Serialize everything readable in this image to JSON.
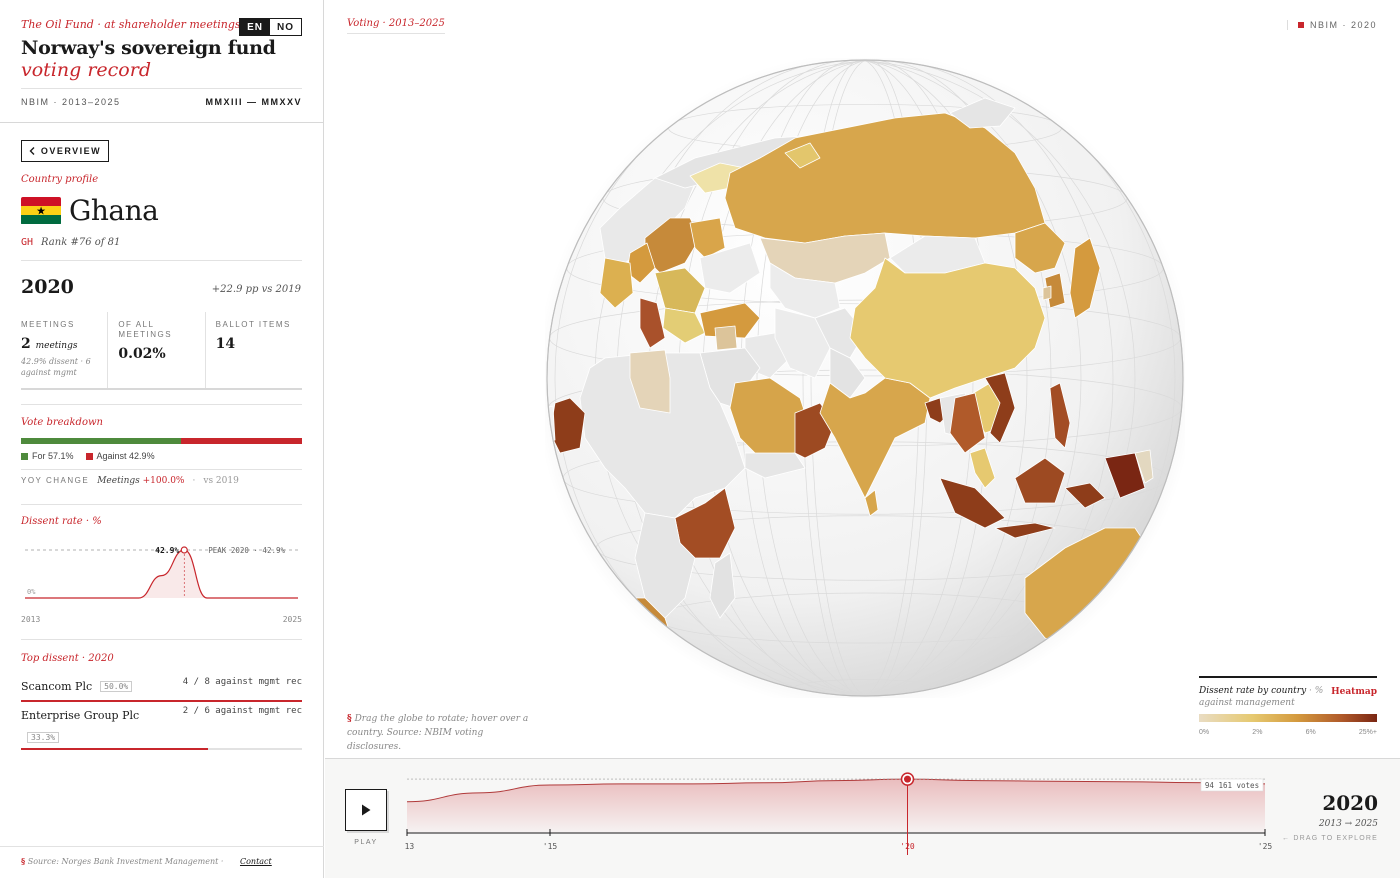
{
  "header": {
    "kicker": "The Oil Fund · at shareholder meetings",
    "title_line1": "Norway's sovereign fund",
    "title_line2": "voting record",
    "lang_en": "EN",
    "lang_no": "NO",
    "meta_left": "NBIM · 2013–2025",
    "meta_right": "MMXIII — MMXXV"
  },
  "profile": {
    "overview_label": "OVERVIEW",
    "section_label": "Country profile",
    "country": "Ghana",
    "code": "GH",
    "rank": "Rank #76 of 81",
    "year": "2020",
    "yoy": "+22.9 pp vs 2019",
    "stats": {
      "meetings_key": "MEETINGS",
      "meetings_value": "2",
      "meetings_unit": "meetings",
      "meetings_note": "42.9% dissent · 6 against mgmt",
      "share_key": "OF ALL MEETINGS",
      "share_value": "0.02%",
      "ballot_key": "BALLOT ITEMS",
      "ballot_value": "14"
    },
    "vote_label": "Vote breakdown",
    "vote_for_pct": 57.1,
    "vote_against_pct": 42.9,
    "vote_for_label": "For 57.1%",
    "vote_against_label": "Against 42.9%",
    "yoy_key": "YOY CHANGE",
    "yoy_metric": "Meetings",
    "yoy_value": "+100.0%",
    "yoy_vs": "vs 2019",
    "dissent_label": "Dissent rate · %",
    "top_label": "Top dissent · 2020",
    "top": [
      {
        "name": "Scancom Plc",
        "pct": "50.0%",
        "count": "4 / 8 against mgmt rec",
        "share": 1.0
      },
      {
        "name": "Enterprise Group Plc",
        "pct": "33.3%",
        "count": "2 / 6 against mgmt rec",
        "share": 0.667
      }
    ],
    "footer_source": "Source: Norges Bank Investment Management",
    "footer_contact": "Contact",
    "footer_mark": "§"
  },
  "chart_data": [
    {
      "type": "line",
      "title": "Dissent rate · %",
      "x": [
        2013,
        2014,
        2015,
        2016,
        2017,
        2018,
        2019,
        2020,
        2021,
        2022,
        2023,
        2024,
        2025
      ],
      "values": [
        0,
        0,
        0,
        0,
        0,
        0,
        20.0,
        42.9,
        0,
        0,
        0,
        0,
        0
      ],
      "ylim": [
        0,
        42.9
      ],
      "peak_label": "42.9%",
      "peak_note": "PEAK 2020 · 42.9%",
      "zero_label": "0%",
      "x_start_label": "2013",
      "x_end_label": "2025"
    },
    {
      "type": "area",
      "x": [
        2013,
        2014,
        2015,
        2016,
        2017,
        2018,
        2019,
        2020,
        2021,
        2022,
        2023,
        2024,
        2025
      ],
      "values": [
        84000,
        88000,
        91500,
        92000,
        92000,
        92500,
        93500,
        94161,
        93500,
        93200,
        93000,
        92600,
        92000
      ],
      "ylim": [
        0,
        96000
      ],
      "tick_labels": [
        "'13",
        "'15",
        "'20",
        "'25"
      ],
      "tick_years": [
        2013,
        2015,
        2020,
        2025
      ],
      "selected_year": 2020,
      "selected_label": "94 161 votes"
    }
  ],
  "map": {
    "tag": "Voting · 2013–2025",
    "corner": "NBIM · 2020",
    "hint_mark": "§",
    "hint": "Drag the globe to rotate; hover over a country. Source: NBIM voting disclosures.",
    "legend_title": "Dissent rate by country",
    "legend_unit": " · %",
    "legend_sub": "against management",
    "legend_mode": "Heatmap",
    "legend_ticks": [
      "0%",
      "2%",
      "6%",
      "25%+"
    ]
  },
  "timeline": {
    "play_label": "PLAY",
    "year": "2020",
    "range": "2013 → 2025",
    "hint": "← DRAG TO EXPLORE"
  },
  "colors": {
    "accent": "#c8262c",
    "for": "#4e8a3c",
    "against": "#c8262c",
    "ghana_red": "#ce1126",
    "ghana_gold": "#fcd116",
    "ghana_green": "#006b3f"
  }
}
